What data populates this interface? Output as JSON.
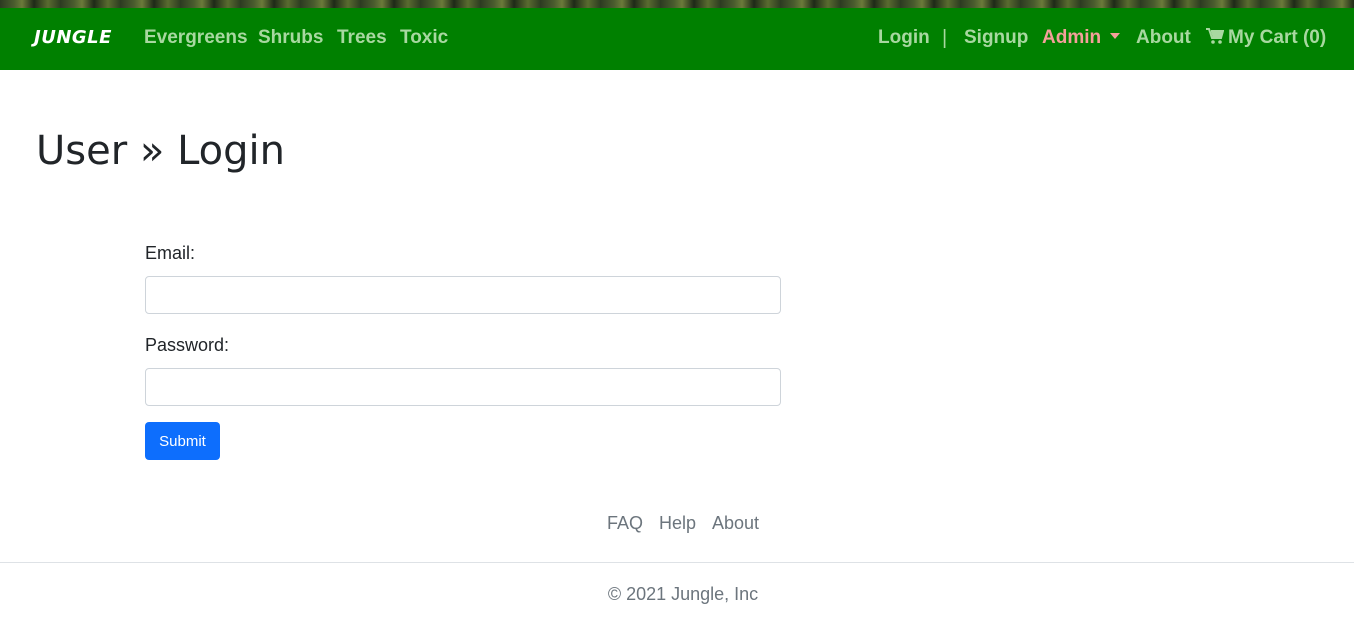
{
  "navbar": {
    "brand": "JUNGLE",
    "categories": [
      "Evergreens",
      "Shrubs",
      "Trees",
      "Toxic"
    ],
    "login": "Login",
    "divider": "|",
    "signup": "Signup",
    "admin": "Admin",
    "about": "About",
    "cart": "My Cart (0)",
    "cart_icon": "cart-icon",
    "background_color": "#008000",
    "link_color": "#a8d8a0",
    "admin_color": "#f4a09a"
  },
  "main": {
    "title": "User » Login",
    "email_label": "Email:",
    "email_value": "",
    "password_label": "Password:",
    "password_value": "",
    "submit_label": "Submit",
    "submit_color": "#0d6efd"
  },
  "footer": {
    "links": [
      "FAQ",
      "Help",
      "About"
    ],
    "copyright": "© 2021 Jungle, Inc"
  }
}
